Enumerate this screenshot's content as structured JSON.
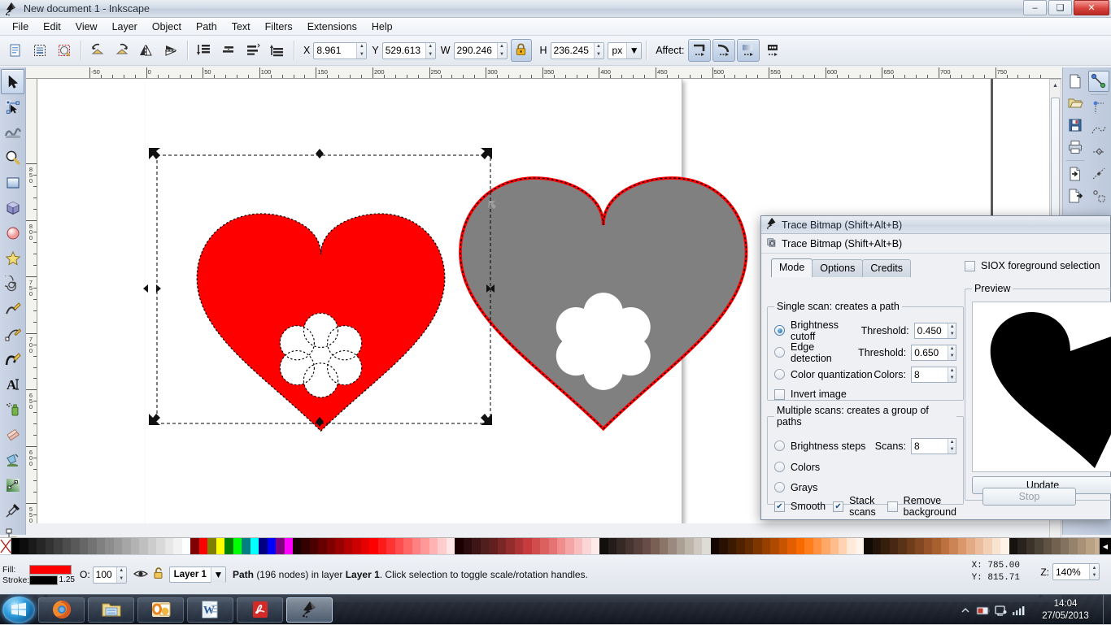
{
  "window": {
    "title": "New document 1 - Inkscape",
    "app_icon": "inkscape-logo-icon",
    "minimize": "–",
    "maximize": "❑",
    "close": "✕"
  },
  "menubar": {
    "items": [
      {
        "label": "File",
        "mnemonic": "F"
      },
      {
        "label": "Edit",
        "mnemonic": "E"
      },
      {
        "label": "View",
        "mnemonic": "V"
      },
      {
        "label": "Layer",
        "mnemonic": "L"
      },
      {
        "label": "Object",
        "mnemonic": "O"
      },
      {
        "label": "Path",
        "mnemonic": "P"
      },
      {
        "label": "Text",
        "mnemonic": "T"
      },
      {
        "label": "Filters",
        "mnemonic": "s"
      },
      {
        "label": "Extensions",
        "mnemonic": "n"
      },
      {
        "label": "Help",
        "mnemonic": "H"
      }
    ]
  },
  "command_toolbar": {
    "buttons": [
      {
        "name": "select-all-icon"
      },
      {
        "name": "select-all-in-all-layers-icon"
      },
      {
        "name": "deselect-icon"
      },
      {
        "name": "rotate-counter-clockwise-icon"
      },
      {
        "name": "rotate-clockwise-icon"
      },
      {
        "name": "flip-horizontal-icon"
      },
      {
        "name": "flip-vertical-icon"
      },
      {
        "name": "lower-to-bottom-icon"
      },
      {
        "name": "lower-one-step-icon"
      },
      {
        "name": "raise-one-step-icon"
      },
      {
        "name": "raise-to-top-icon"
      }
    ],
    "x_label": "X",
    "x_value": "8.961",
    "y_label": "Y",
    "y_value": "529.613",
    "w_label": "W",
    "w_value": "290.246",
    "h_label": "H",
    "h_value": "236.245",
    "lock_icon": "lock-closed-icon",
    "units": "px",
    "affect_label": "Affect:",
    "affect_buttons": [
      {
        "name": "affect-stroke-width-icon",
        "pressed": true
      },
      {
        "name": "affect-rounded-corners-icon",
        "pressed": true
      },
      {
        "name": "affect-gradients-icon",
        "pressed": true
      },
      {
        "name": "affect-patterns-icon",
        "pressed": false
      }
    ]
  },
  "toolbox": {
    "tools": [
      {
        "name": "selector-tool",
        "icon": "arrow-cursor-icon",
        "active": true
      },
      {
        "name": "node-tool",
        "icon": "node-editor-icon",
        "active": false
      },
      {
        "name": "tweak-tool",
        "icon": "tweak-icon",
        "active": false
      },
      {
        "name": "zoom-tool",
        "icon": "magnifier-icon",
        "active": false
      },
      {
        "name": "rectangle-tool",
        "icon": "rectangle-icon",
        "active": false
      },
      {
        "name": "box3d-tool",
        "icon": "cube-icon",
        "active": false
      },
      {
        "name": "ellipse-tool",
        "icon": "ellipse-icon",
        "active": false
      },
      {
        "name": "star-tool",
        "icon": "star-icon",
        "active": false
      },
      {
        "name": "spiral-tool",
        "icon": "spiral-icon",
        "active": false
      },
      {
        "name": "pencil-tool",
        "icon": "pencil-icon",
        "active": false
      },
      {
        "name": "pen-tool",
        "icon": "bezier-pen-icon",
        "active": false
      },
      {
        "name": "calligraphy-tool",
        "icon": "calligraphy-pen-icon",
        "active": false
      },
      {
        "name": "text-tool",
        "icon": "text-a-icon",
        "active": false
      },
      {
        "name": "spray-tool",
        "icon": "spray-can-icon",
        "active": false
      },
      {
        "name": "eraser-tool",
        "icon": "eraser-icon",
        "active": false
      },
      {
        "name": "paintbucket-tool",
        "icon": "paint-bucket-icon",
        "active": false
      },
      {
        "name": "gradient-tool",
        "icon": "gradient-icon",
        "active": false
      },
      {
        "name": "dropper-tool",
        "icon": "eyedropper-icon",
        "active": false
      },
      {
        "name": "connector-tool",
        "icon": "connector-icon",
        "active": false
      }
    ]
  },
  "rulers": {
    "horizontal_labels": [
      "-50",
      "0",
      "50",
      "100",
      "150",
      "200",
      "250",
      "300",
      "350",
      "400",
      "450",
      "500",
      "550",
      "600",
      "650",
      "700",
      "750"
    ],
    "vertical_labels": [
      "850",
      "800",
      "750",
      "700",
      "650",
      "600",
      "550"
    ]
  },
  "canvas": {
    "objects": [
      {
        "name": "red-heart-path",
        "fill": "#ff0000",
        "selected": true,
        "cutout": "flower-6-petal"
      },
      {
        "name": "gray-heart-image",
        "fill": "#808080",
        "traced_outline": "#ff0000",
        "cutout": "flower-6-petal"
      }
    ],
    "selection_handles": "scale-arrows"
  },
  "right_dock": {
    "buttons": [
      {
        "name": "new-document-icon"
      },
      {
        "name": "open-document-icon"
      },
      {
        "name": "save-document-icon"
      },
      {
        "name": "print-document-icon"
      },
      {
        "name": "import-icon"
      },
      {
        "name": "export-icon"
      },
      {
        "name": "snap-enable-icon",
        "active": true
      },
      {
        "name": "snap-nodes-icon"
      },
      {
        "name": "snap-paths-icon"
      },
      {
        "name": "snap-bbox-icon"
      },
      {
        "name": "snap-midpoints-icon"
      },
      {
        "name": "snap-centers-icon"
      },
      {
        "name": "snap-grid-icon"
      }
    ]
  },
  "trace_dialog": {
    "window_title": "Trace Bitmap (Shift+Alt+B)",
    "panel_title": "Trace Bitmap (Shift+Alt+B)",
    "window_icon": "inkscape-logo-icon",
    "panel_icon": "trace-bitmap-icon",
    "tabs": [
      {
        "label": "Mode",
        "active": true
      },
      {
        "label": "Options",
        "active": false
      },
      {
        "label": "Credits",
        "active": false
      }
    ],
    "single_scan": {
      "legend": "Single scan: creates a path",
      "options": [
        {
          "label": "Brightness cutoff",
          "selected": true,
          "field_label": "Threshold:",
          "field_value": "0.450"
        },
        {
          "label": "Edge detection",
          "selected": false,
          "field_label": "Threshold:",
          "field_value": "0.650"
        },
        {
          "label": "Color quantization",
          "selected": false,
          "field_label": "Colors:",
          "field_value": "8"
        }
      ],
      "invert_image": {
        "label": "Invert image",
        "checked": false
      }
    },
    "multiple_scans": {
      "legend": "Multiple scans: creates a group of paths",
      "options": [
        {
          "label": "Brightness steps",
          "selected": false,
          "field_label": "Scans:",
          "field_value": "8"
        },
        {
          "label": "Colors",
          "selected": false,
          "field_label": "",
          "field_value": ""
        },
        {
          "label": "Grays",
          "selected": false,
          "field_label": "",
          "field_value": ""
        }
      ],
      "checkboxes": [
        {
          "label": "Smooth",
          "checked": true
        },
        {
          "label": "Stack scans",
          "checked": true
        },
        {
          "label": "Remove background",
          "checked": false
        }
      ]
    },
    "siox": {
      "label": "SIOX foreground selection",
      "checked": false
    },
    "preview": {
      "legend": "Preview",
      "content": "traced-heart-silhouette"
    },
    "update_button": "Update",
    "stop_button": "Stop",
    "stop_disabled": true
  },
  "statusbar": {
    "fill_label": "Fill:",
    "fill_color": "#ff0000",
    "stroke_label": "Stroke:",
    "stroke_color": "#000000",
    "stroke_width": "1.25",
    "opacity_label": "O:",
    "opacity_value": "100",
    "layer_visibility_icon": "eye-icon",
    "layer_lock_icon": "unlocked-icon",
    "layer_name": "Layer 1",
    "message_prefix": "Path",
    "message_nodes": "(196 nodes)",
    "message_middle": " in layer ",
    "message_layer": "Layer 1",
    "message_suffix": ". Click selection to toggle scale/rotation handles.",
    "x_label": "X:",
    "x_value": "785.00",
    "y_label": "Y:",
    "y_value": "815.71",
    "zoom_label": "Z:",
    "zoom_value": "140%"
  },
  "palette": {
    "none_swatch": "none-x-icon",
    "colors": [
      "#000000",
      "#0d0d0d",
      "#1a1a1a",
      "#262626",
      "#333333",
      "#404040",
      "#4d4d4d",
      "#595959",
      "#666666",
      "#737373",
      "#808080",
      "#8c8c8c",
      "#999999",
      "#a6a6a6",
      "#b3b3b3",
      "#bfbfbf",
      "#cccccc",
      "#d9d9d9",
      "#e6e6e6",
      "#f2f2f2",
      "#ffffff",
      "#800000",
      "#ff0000",
      "#808000",
      "#ffff00",
      "#008000",
      "#00ff00",
      "#008080",
      "#00ffff",
      "#000080",
      "#0000ff",
      "#800080",
      "#ff00ff",
      "#1a0000",
      "#330000",
      "#4d0000",
      "#660000",
      "#800000",
      "#990000",
      "#b30000",
      "#cc0000",
      "#e60000",
      "#ff0000",
      "#ff1a1a",
      "#ff3333",
      "#ff4d4d",
      "#ff6666",
      "#ff8080",
      "#ff9999",
      "#ffb3b3",
      "#ffcccc",
      "#ffe6e6",
      "#1a0000",
      "#2b0b0b",
      "#3d1515",
      "#4f1f1f",
      "#611f1f",
      "#7a2626",
      "#932d2d",
      "#ad3434",
      "#c63b3b",
      "#d14d4d",
      "#dc6060",
      "#e67373",
      "#ef8c8c",
      "#f5a5a5",
      "#f8bdbd",
      "#fbd6d6",
      "#fdeaea",
      "#130f0e",
      "#241c1a",
      "#352825",
      "#463431",
      "#57403c",
      "#684c47",
      "#796052",
      "#8a7468",
      "#9b887e",
      "#aca094",
      "#bdb4aa",
      "#cec8c0",
      "#dfdcd6",
      "#140600",
      "#281100",
      "#3c1a00",
      "#502200",
      "#642b00",
      "#7d3600",
      "#964000",
      "#af4a00",
      "#c85400",
      "#e15f00",
      "#f86a00",
      "#ff7d1a",
      "#ff9140",
      "#ffa766",
      "#ffbd8c",
      "#ffd3b2",
      "#ffe9d8",
      "#fff4ec",
      "#120a04",
      "#241409",
      "#361e0d",
      "#482812",
      "#5a3217",
      "#6e3d1c",
      "#824822",
      "#965428",
      "#a9602f",
      "#bd7040",
      "#cc8455",
      "#d9976b",
      "#e3aa83",
      "#ebbd9c",
      "#f2d0b6",
      "#f8e3d1",
      "#fdf3e8",
      "#16120f",
      "#29221c",
      "#3b3229",
      "#4d4236",
      "#5f5243",
      "#716250",
      "#83725d",
      "#95826a",
      "#a79277",
      "#b9a284",
      "#c6b195",
      "#d3c0a6"
    ],
    "scroll_icon": "palette-scroll-icon"
  },
  "taskbar": {
    "start_icon": "windows-start-orb-icon",
    "items": [
      {
        "name": "firefox-icon",
        "active": false
      },
      {
        "name": "file-explorer-icon",
        "active": false
      },
      {
        "name": "outlook-icon",
        "active": false
      },
      {
        "name": "word-icon",
        "active": false
      },
      {
        "name": "acrobat-reader-icon",
        "active": false
      },
      {
        "name": "inkscape-icon",
        "active": true
      }
    ],
    "tray": [
      {
        "name": "show-hidden-icons-icon"
      },
      {
        "name": "battery-icon"
      },
      {
        "name": "network-icon"
      },
      {
        "name": "volume-icon"
      }
    ],
    "time": "14:04",
    "date": "27/05/2013"
  }
}
